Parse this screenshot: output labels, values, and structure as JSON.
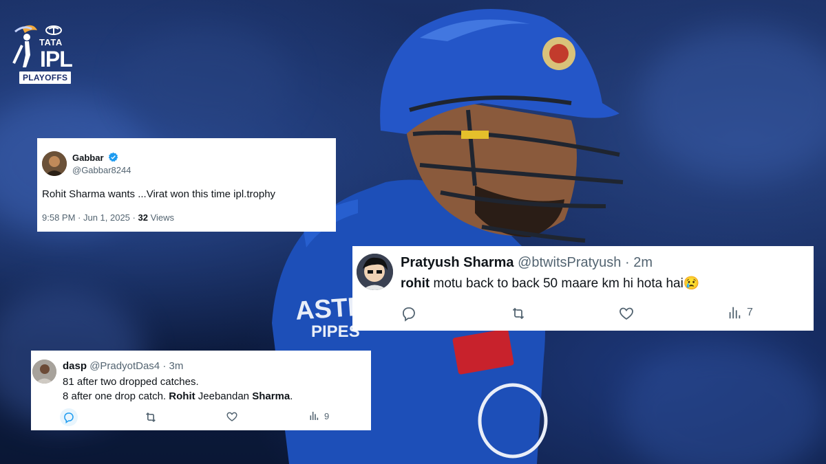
{
  "logo": {
    "tata": "TATA",
    "ipl": "IPL",
    "playoffs": "PLAYOFFS"
  },
  "tweet1": {
    "name": "Gabbar",
    "handle": "@Gabbar8244",
    "text": "Rohit Sharma wants ...Virat won this time ipl.trophy",
    "time": "9:58 PM · Jun 1, 2025 ·",
    "views_count": "32",
    "views_label": "Views",
    "verified": true
  },
  "tweet2": {
    "name": "Pratyush Sharma",
    "handle": "@btwitsPratyush",
    "time": "· 2m",
    "bold_word": "rohit",
    "text": "motu back to back 50 maare km hi hota hai",
    "emoji": "😢",
    "views": "7"
  },
  "tweet3": {
    "name": "dasp",
    "handle": "@PradyotDas4",
    "time": "· 3m",
    "line1": "81 after two dropped catches.",
    "line2_prefix": "8 after one drop catch.",
    "line2_b1": "Rohit",
    "line2_mid": "Jeebandan",
    "line2_b2": "Sharma",
    "line2_end": ".",
    "views": "9"
  },
  "colors": {
    "accent": "#1d9bf0",
    "muted": "#536471",
    "mi_blue": "#1d4fb8"
  }
}
